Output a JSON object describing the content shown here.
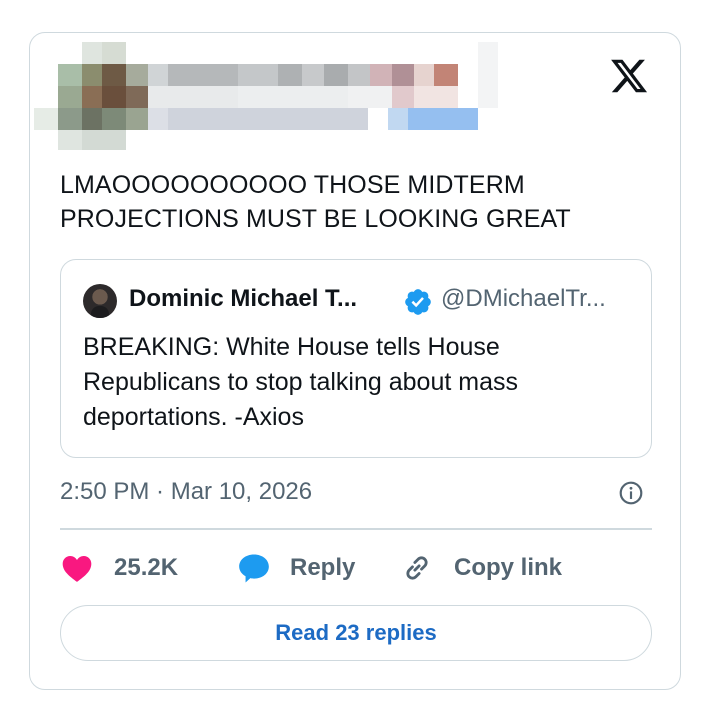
{
  "tweet": {
    "text": "LMAOOOOOOOOOO THOSE MIDTERM PROJECTIONS MUST BE LOOKING GREAT",
    "author_blurred": true,
    "timestamp": "2:50 PM · Mar 10, 2026"
  },
  "quote": {
    "name": "Dominic Michael T...",
    "handle": "@DMichaelTr...",
    "verified": true,
    "text": "BREAKING: White House tells House Republicans to stop talking about mass deportations. -Axios"
  },
  "actions": {
    "like_count": "25.2K",
    "reply_label": "Reply",
    "copy_label": "Copy link"
  },
  "read_replies_label": "Read 23 replies",
  "icons": {
    "brand": "x-logo-icon",
    "like": "heart-icon",
    "reply": "speech-bubble-icon",
    "copy": "link-icon",
    "info": "info-icon",
    "verified": "verified-badge-icon"
  },
  "colors": {
    "like": "#f91880",
    "reply": "#1d9bf0",
    "link": "#1d6bc4",
    "muted": "#536471",
    "border": "#cfd9de"
  }
}
